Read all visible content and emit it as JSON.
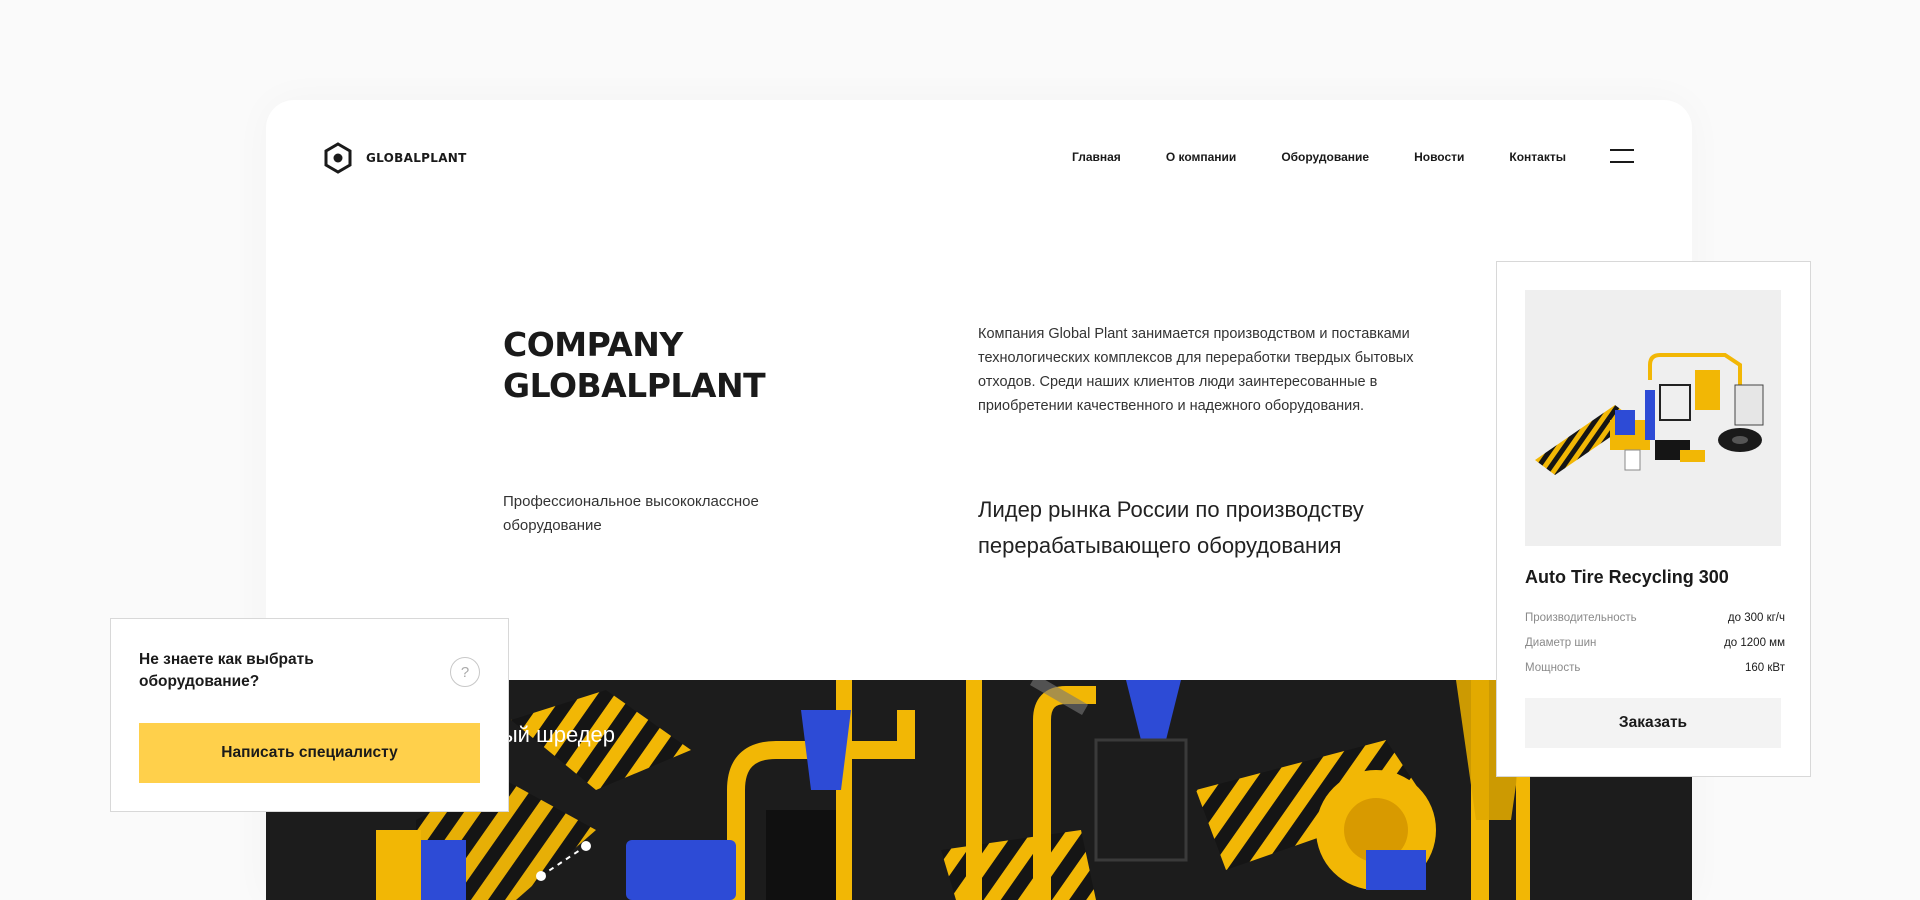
{
  "brand": {
    "name": "GLOBALPLANT",
    "icon": "hexagon-logo-icon"
  },
  "nav": {
    "items": [
      {
        "label": "Главная"
      },
      {
        "label": "О компании"
      },
      {
        "label": "Оборудование"
      },
      {
        "label": "Новости"
      },
      {
        "label": "Контакты"
      }
    ],
    "menu_icon": "burger-menu-icon"
  },
  "hero": {
    "title_line1": "COMPANY",
    "title_line2": "GLOBALPLANT",
    "subtitle": "Профессиональное высококлассное оборудование",
    "about": "Компания Global Plant занимается производством и поставками технологических комплексов для переработки твердых бытовых отходов. Среди наших клиентов люди заинтересованные в приобретении  качественного и надежного оборудования.",
    "lead": "Лидер рынка России по производству перерабатывающего оборудования",
    "callout": "Первичный шредер"
  },
  "help_card": {
    "title": "Не знаете как выбрать оборудование?",
    "question_mark": "?",
    "button_label": "Написать специалисту"
  },
  "product_card": {
    "name": "Auto Tire Recycling 300",
    "specs": [
      {
        "label": "Производительность",
        "value": "до 300 кг/ч"
      },
      {
        "label": "Диаметр шин",
        "value": "до 1200 мм"
      },
      {
        "label": "Мощность",
        "value": "160 кВт"
      }
    ],
    "button_label": "Заказать"
  },
  "colors": {
    "accent_yellow": "#ffd04b",
    "dark_bg": "#1c1c1c",
    "machine_yellow": "#f2b705",
    "machine_blue": "#2d4bd6"
  }
}
